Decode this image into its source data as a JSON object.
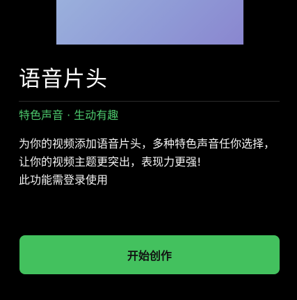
{
  "banner": {
    "gradient_start": "#9ab0dc",
    "gradient_end": "#8a86cf"
  },
  "feature": {
    "title": "语音片头",
    "tagline": "特色声音 · 生动有趣",
    "description": "为你的视频添加语音片头，多种特色声音任你选择，让你的视频主题更突出，表现力更强!",
    "login_note": "此功能需登录使用"
  },
  "actions": {
    "start_label": "开始创作"
  },
  "colors": {
    "background": "#000000",
    "accent": "#43c15e",
    "tagline": "#4cc86c"
  }
}
